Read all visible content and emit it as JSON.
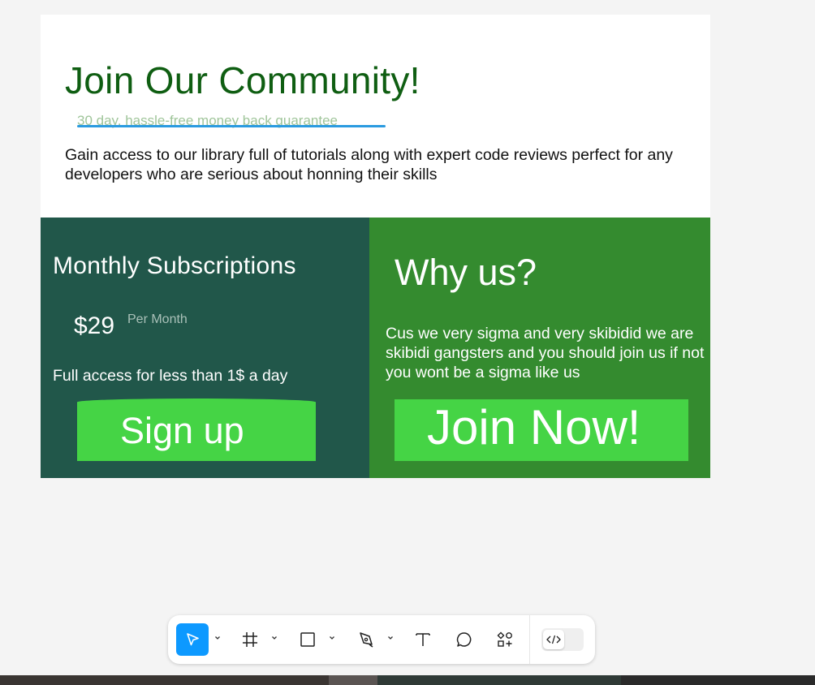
{
  "hero": {
    "title": "Join Our Community!",
    "guarantee": "30 day, hassle-free money back guarantee",
    "description": "Gain access to our library full of tutorials along with expert code reviews perfect for any developers who are serious about honning their skills"
  },
  "subscription": {
    "title": "Monthly Subscriptions",
    "price": "$29",
    "period": "Per Month",
    "tagline": "Full access for less than 1$ a day",
    "button_label": "Sign up"
  },
  "why": {
    "title": "Why us?",
    "text": "Cus we very sigma and very skibidid we are skibidi gangsters and you should join us if not you wont be a sigma like us",
    "button_label": "Join Now!"
  },
  "colors": {
    "title_green": "#0f5e12",
    "left_panel": "#21574a",
    "right_panel": "#348b2f",
    "button_green": "#45d445",
    "toolbar_active": "#0d99ff",
    "underline_blue": "#2a9be0"
  },
  "toolbar": {
    "tools": [
      "move-tool-icon",
      "frame-tool-icon",
      "rectangle-tool-icon",
      "pen-tool-icon",
      "text-tool-icon",
      "comment-tool-icon",
      "components-tool-icon"
    ],
    "active_tool": "move-tool-icon",
    "code_toggle": "dev-mode-icon"
  }
}
